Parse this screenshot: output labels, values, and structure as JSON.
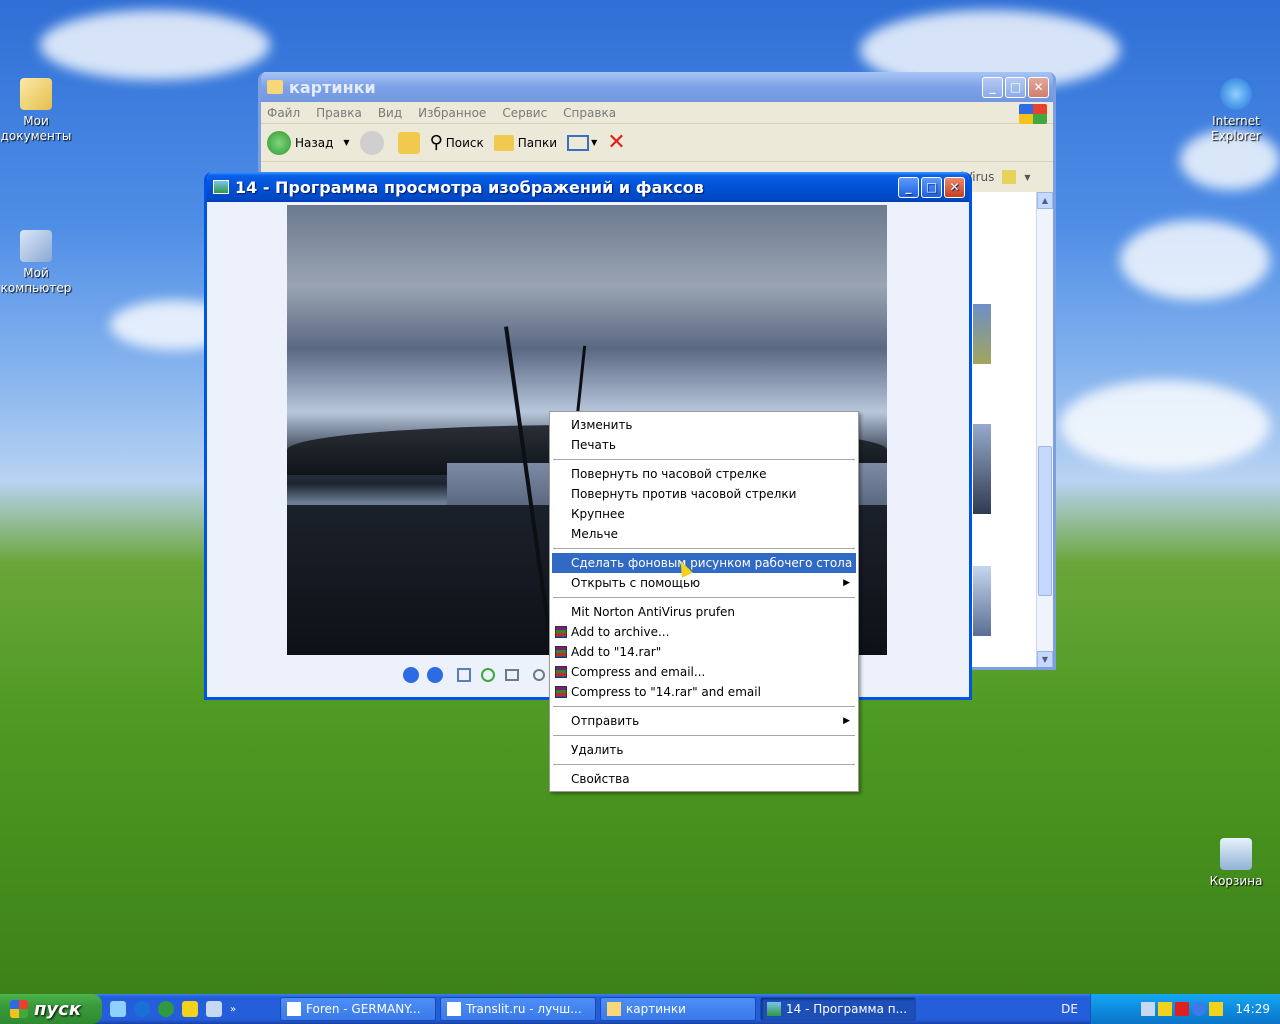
{
  "desktop": {
    "icons": [
      {
        "label": "Мои документы"
      },
      {
        "label": "Мой компьютер"
      },
      {
        "label": "Internet Explorer"
      },
      {
        "label": "Корзина"
      }
    ]
  },
  "explorer": {
    "title": "картинки",
    "menu": [
      "Файл",
      "Правка",
      "Вид",
      "Избранное",
      "Сервис",
      "Справка"
    ],
    "toolbar": {
      "back": "Назад",
      "search": "Поиск",
      "folders": "Папки"
    },
    "antivirus_label": "iVirus"
  },
  "viewer": {
    "title": "14 - Программа просмотра изображений и факсов"
  },
  "context_menu": {
    "items": [
      {
        "label": "Изменить"
      },
      {
        "label": "Печать"
      },
      {
        "label": "Повернуть по часовой стрелке"
      },
      {
        "label": "Повернуть против часовой стрелки"
      },
      {
        "label": "Крупнее"
      },
      {
        "label": "Мельче"
      },
      {
        "label": "Сделать фоновым рисунком рабочего стола"
      },
      {
        "label": "Открыть с помощью"
      },
      {
        "label": "Mit Norton AntiVirus prufen"
      },
      {
        "label": "Add to archive..."
      },
      {
        "label": "Add to \"14.rar\""
      },
      {
        "label": "Compress and email..."
      },
      {
        "label": "Compress to \"14.rar\" and email"
      },
      {
        "label": "Отправить"
      },
      {
        "label": "Удалить"
      },
      {
        "label": "Свойства"
      }
    ]
  },
  "taskbar": {
    "start_label": "пуск",
    "tasks": [
      {
        "label": "Foren - GERMANY..."
      },
      {
        "label": "Translit.ru - лучш..."
      },
      {
        "label": "картинки"
      },
      {
        "label": "14 - Программа п..."
      }
    ],
    "language": "DE",
    "clock": "14:29"
  },
  "colors": {
    "titlebar_active": "#0052d6",
    "menu_highlight": "#316ac5",
    "taskbar": "#245edb",
    "start_button": "#3a9a3a"
  }
}
